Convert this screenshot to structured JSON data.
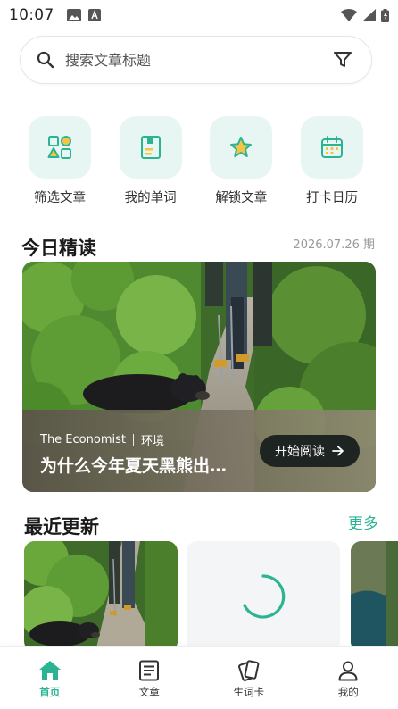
{
  "status_bar": {
    "time": "10:07"
  },
  "search": {
    "placeholder": "搜索文章标题"
  },
  "quick_actions": [
    {
      "label": "筛选文章",
      "icon": "shapes-filter-icon"
    },
    {
      "label": "我的单词",
      "icon": "word-book-icon"
    },
    {
      "label": "解锁文章",
      "icon": "star-icon"
    },
    {
      "label": "打卡日历",
      "icon": "calendar-icon"
    }
  ],
  "daily": {
    "section_title": "今日精读",
    "date": "2026.07.26 期",
    "source": "The Economist",
    "category": "环境",
    "title": "为什么今年夏天黑熊出…",
    "read_button": "开始阅读"
  },
  "recent": {
    "section_title": "最近更新",
    "more_label": "更多"
  },
  "bottom_nav": [
    {
      "label": "首页",
      "icon": "home-icon",
      "active": true
    },
    {
      "label": "文章",
      "icon": "article-icon",
      "active": false
    },
    {
      "label": "生词卡",
      "icon": "flashcard-icon",
      "active": false
    },
    {
      "label": "我的",
      "icon": "profile-icon",
      "active": false
    }
  ],
  "colors": {
    "accent": "#2bb494",
    "icon_bg": "#e8f6f3",
    "button_dark": "#1e2422"
  }
}
